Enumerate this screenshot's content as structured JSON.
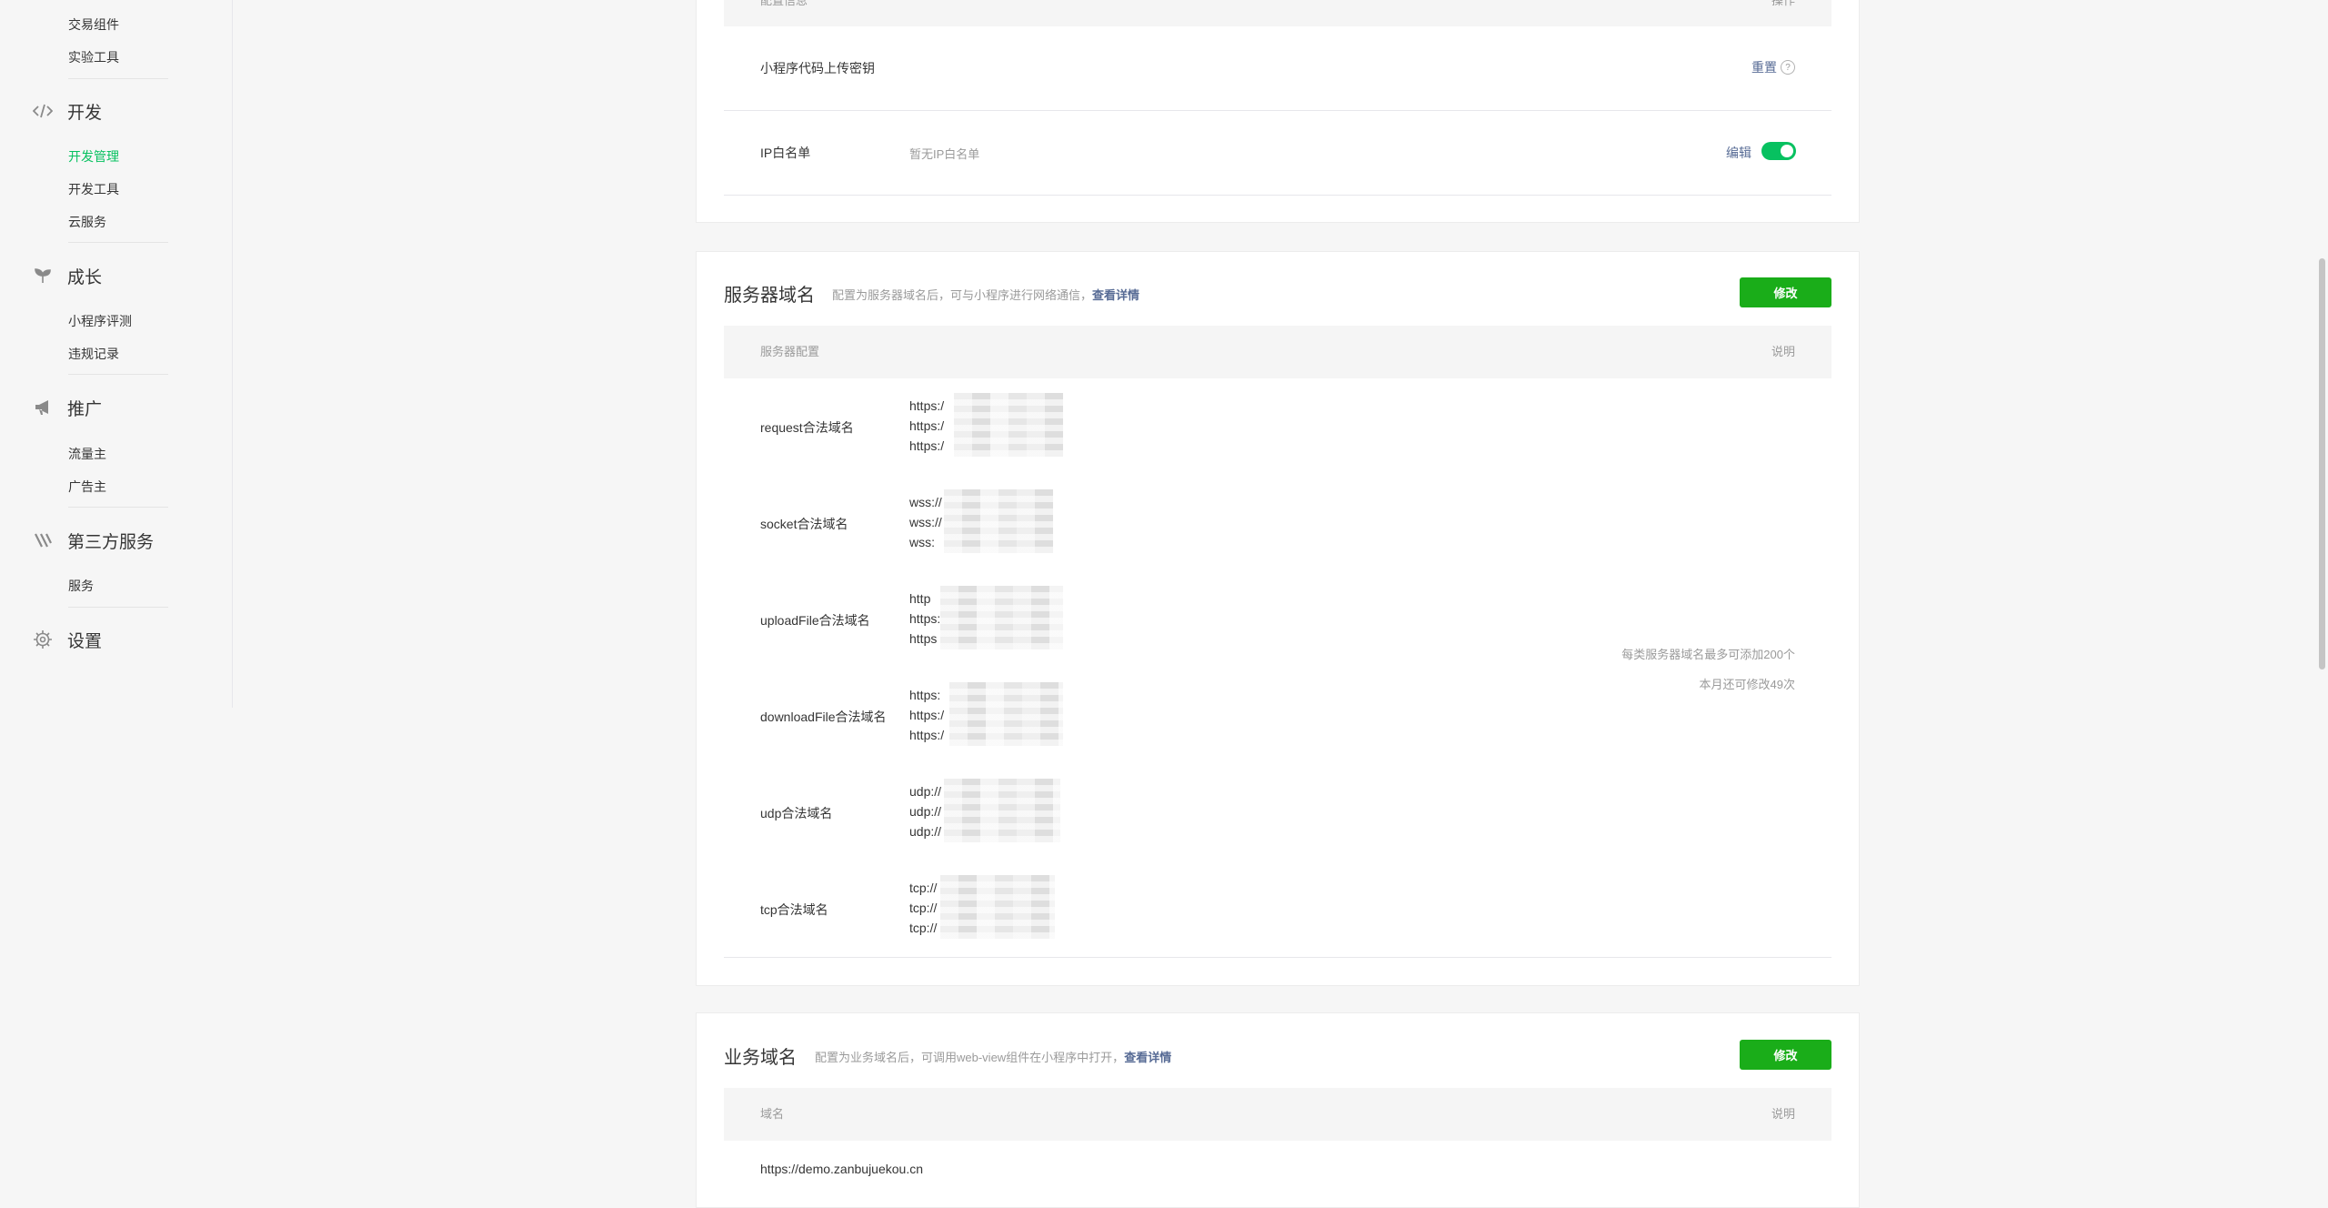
{
  "sidebar": {
    "items_top": [
      "交易组件",
      "实验工具"
    ],
    "groups": [
      {
        "label": "开发",
        "icon": "code-icon",
        "items": [
          "开发管理",
          "开发工具",
          "云服务"
        ]
      },
      {
        "label": "成长",
        "icon": "sprout-icon",
        "items": [
          "小程序评测",
          "违规记录"
        ]
      },
      {
        "label": "推广",
        "icon": "megaphone-icon",
        "items": [
          "流量主",
          "广告主"
        ]
      },
      {
        "label": "第三方服务",
        "icon": "third-party-icon",
        "items": [
          "服务"
        ]
      },
      {
        "label": "设置",
        "icon": "gear-icon",
        "items": []
      }
    ],
    "active_item": "开发管理",
    "active_color": "#07c160"
  },
  "dev_settings": {
    "header_left": "配置信息",
    "header_right": "操作",
    "upload_key_label": "小程序代码上传密钥",
    "upload_key_action": "重置",
    "ip_whitelist_label": "IP白名单",
    "ip_whitelist_value": "暂无IP白名单",
    "ip_whitelist_action": "编辑",
    "ip_whitelist_enabled": true
  },
  "server_domains": {
    "title": "服务器域名",
    "desc": "配置为服务器域名后，可与小程序进行网络通信，",
    "desc_link": "查看详情",
    "modify_button": "修改",
    "col_config": "服务器配置",
    "col_note": "说明",
    "rows": [
      {
        "label": "request合法域名",
        "lines": [
          "https:/",
          "https:/",
          "https:/"
        ]
      },
      {
        "label": "socket合法域名",
        "lines": [
          "wss://",
          "wss://",
          "wss:"
        ]
      },
      {
        "label": "uploadFile合法域名",
        "lines": [
          "http",
          "https:",
          "https"
        ]
      },
      {
        "label": "downloadFile合法域名",
        "lines": [
          "https:",
          "https:/",
          "https:/"
        ]
      },
      {
        "label": "udp合法域名",
        "lines": [
          "udp://",
          "udp://",
          "udp://"
        ]
      },
      {
        "label": "tcp合法域名",
        "lines": [
          "tcp://",
          "tcp://",
          "tcp://"
        ]
      }
    ],
    "note_line1": "每类服务器域名最多可添加200个",
    "note_line2": "本月还可修改49次"
  },
  "business_domains": {
    "title": "业务域名",
    "desc": "配置为业务域名后，可调用web-view组件在小程序中打开，",
    "desc_link": "查看详情",
    "modify_button": "修改",
    "col_domain": "域名",
    "col_note": "说明",
    "domain": "https://demo.zanbujuekou.cn"
  },
  "colors": {
    "primary_green": "#1aad19",
    "link_blue": "#576b95",
    "toggle_green": "#07c160"
  }
}
